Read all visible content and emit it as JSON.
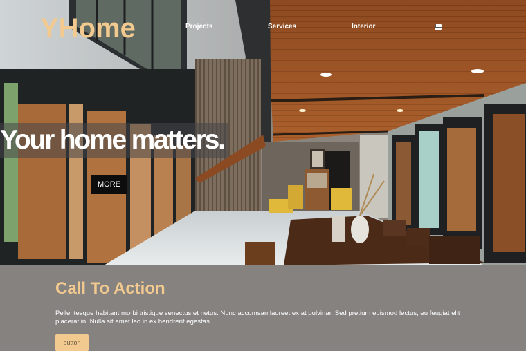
{
  "header": {
    "logo": "YHome",
    "nav": [
      "Projects",
      "Services",
      "Interior"
    ],
    "mail_icon": "envelope-icon"
  },
  "hero": {
    "headline": "Your home matters.",
    "button_label": "MORE"
  },
  "cta": {
    "title": "Call To Action",
    "text": "Pellentesque habitant morbi tristique senectus et netus. Nunc accumsan laoreet ex at pulvinar. Sed pretium euismod lectus, eu feugiat elit placerat in. Nulla sit amet leo in ex hendrerit egestas.",
    "button_label": "button"
  },
  "colors": {
    "accent": "#f2c98e",
    "cta_background": "#858280",
    "button_dark": "#0d0d0d"
  }
}
